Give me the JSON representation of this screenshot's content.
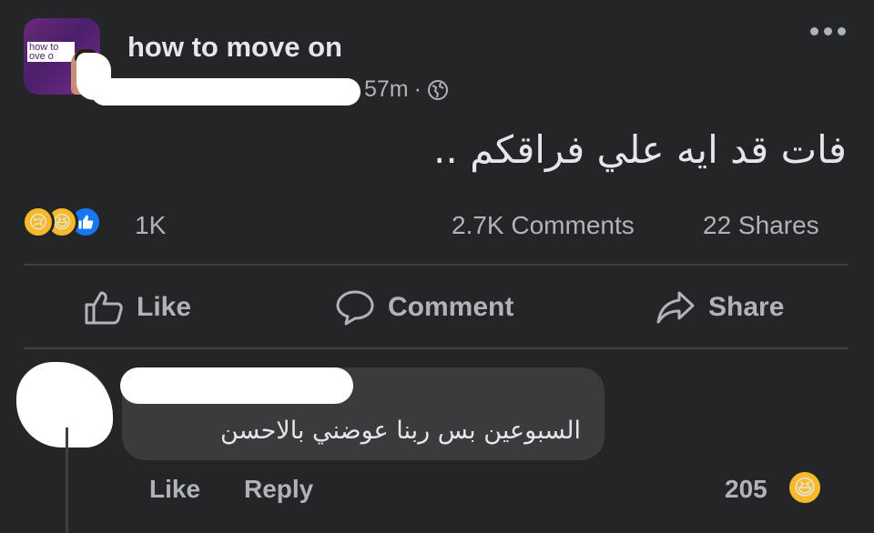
{
  "post": {
    "page_name": "how to move on",
    "avatar_text": "how to\nove o",
    "time": "57m",
    "separator": "·",
    "text": "فات قد ايه علي فراقكم .."
  },
  "stats": {
    "reaction_count": "1K",
    "comments": "2.7K Comments",
    "shares": "22 Shares"
  },
  "actions": {
    "like": "Like",
    "comment": "Comment",
    "share": "Share"
  },
  "comment": {
    "text": "السبوعين بس ربنا عوضني بالاحسن",
    "like": "Like",
    "reply": "Reply",
    "reaction_count": "205"
  },
  "icons": {
    "globe": "globe-icon",
    "more": "more-icon",
    "like": "thumbs-up-icon",
    "comment": "speech-bubble-icon",
    "share": "share-arrow-icon"
  },
  "colors": {
    "background": "#242527",
    "text": "#e4e6eb",
    "muted": "#b0b3b8",
    "bubble": "#3a3b3c",
    "like_blue": "#1877f2",
    "emoji_yellow": "#f7b928"
  }
}
